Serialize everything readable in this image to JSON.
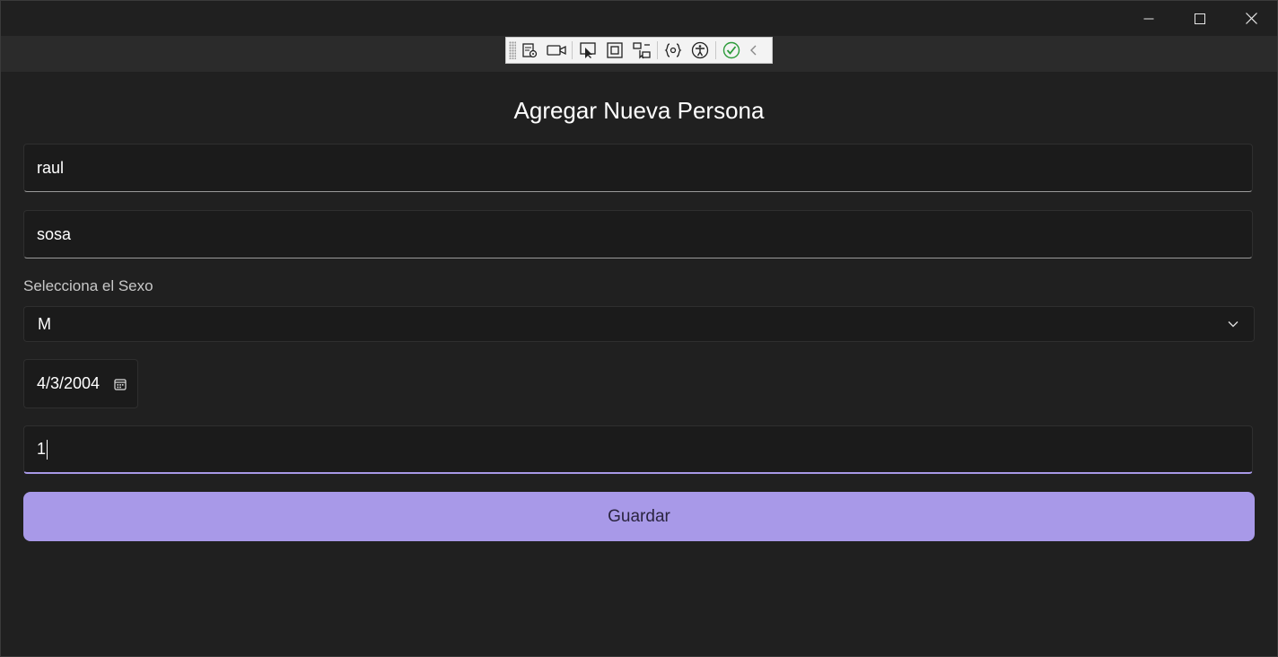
{
  "form": {
    "title": "Agregar Nueva Persona",
    "nombre_value": "raul",
    "apellido_value": "sosa",
    "sexo_label": "Selecciona el Sexo",
    "sexo_selected": "M",
    "fecha_value": "4/3/2004",
    "numero_value": "1",
    "save_label": "Guardar"
  },
  "window": {
    "minimize_icon": "minimize-icon",
    "maximize_icon": "maximize-icon",
    "close_icon": "close-icon"
  },
  "devtools": {
    "icons": [
      "grip-icon",
      "live-visual-tree-icon",
      "record-icon",
      "select-element-icon",
      "display-layout-adorners-icon",
      "track-focus-icon",
      "binding-failures-icon",
      "accessibility-icon",
      "hot-reload-ok-icon",
      "collapse-toolbar-icon"
    ]
  },
  "colors": {
    "background": "#202020",
    "accent": "#a899e8",
    "field_bg": "#1b1b1b"
  }
}
